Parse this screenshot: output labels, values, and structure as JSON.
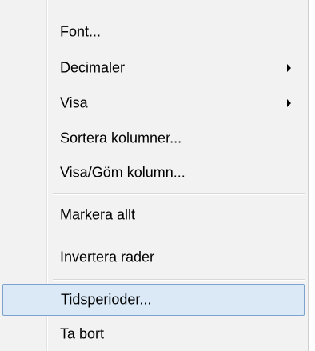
{
  "menu": {
    "items": [
      {
        "label": "Font...",
        "submenu": false
      },
      {
        "label": "Decimaler",
        "submenu": true
      },
      {
        "label": "Visa",
        "submenu": true
      },
      {
        "label": "Sortera kolumner...",
        "submenu": false
      },
      {
        "label": "Visa/Göm kolumn...",
        "submenu": false
      },
      {
        "label": "Markera allt",
        "submenu": false
      },
      {
        "label": "Invertera rader",
        "submenu": false
      },
      {
        "label": "Tidsperioder...",
        "submenu": false,
        "highlighted": true
      },
      {
        "label": "Ta bort",
        "submenu": false
      }
    ]
  },
  "colors": {
    "menu_background": "#f2f2f2",
    "highlight_background": "#dbe9f7",
    "highlight_border": "#7da2ce"
  }
}
